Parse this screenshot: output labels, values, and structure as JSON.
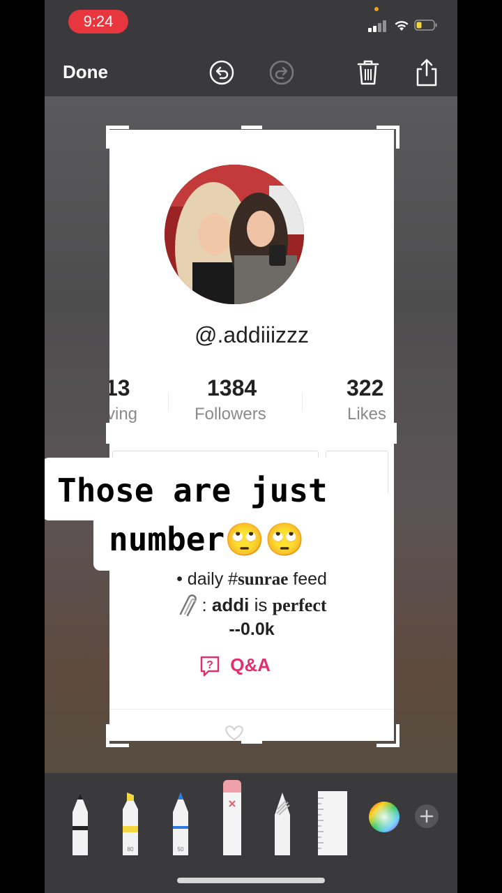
{
  "status_bar": {
    "time": "9:24"
  },
  "toolbar": {
    "done_label": "Done"
  },
  "profile": {
    "username": "@.addiiizzz",
    "stats": [
      {
        "value": "13",
        "label": "ving"
      },
      {
        "value": "1384",
        "label": "Followers"
      },
      {
        "value": "322",
        "label": "Likes"
      }
    ],
    "bio": {
      "line1_prefix": "• daily #",
      "line1_bold": "sunrae",
      "line1_suffix": " feed",
      "line2_sep": ":",
      "line2_bold1": "addi",
      "line2_mid": " is ",
      "line2_bold2": "perfect",
      "line3": "--0.0k"
    },
    "qa_label": "Q&A"
  },
  "caption": {
    "line1": "Those are just",
    "line2": "number🙄🙄"
  },
  "tools": [
    {
      "name": "pen",
      "size": ""
    },
    {
      "name": "marker",
      "size": "80"
    },
    {
      "name": "pencil",
      "size": "50"
    },
    {
      "name": "eraser",
      "size": ""
    },
    {
      "name": "lasso",
      "size": ""
    },
    {
      "name": "ruler",
      "size": ""
    }
  ],
  "icons": {
    "undo": "undo-icon",
    "redo": "redo-icon",
    "trash": "trash-icon",
    "share": "share-icon",
    "color": "color-picker-icon",
    "add": "plus-icon"
  },
  "colors": {
    "status_pill": "#e8363f",
    "accent_pink": "#e3306c",
    "marker_yellow": "#f6d640",
    "pencil_blue": "#2a7be4"
  }
}
